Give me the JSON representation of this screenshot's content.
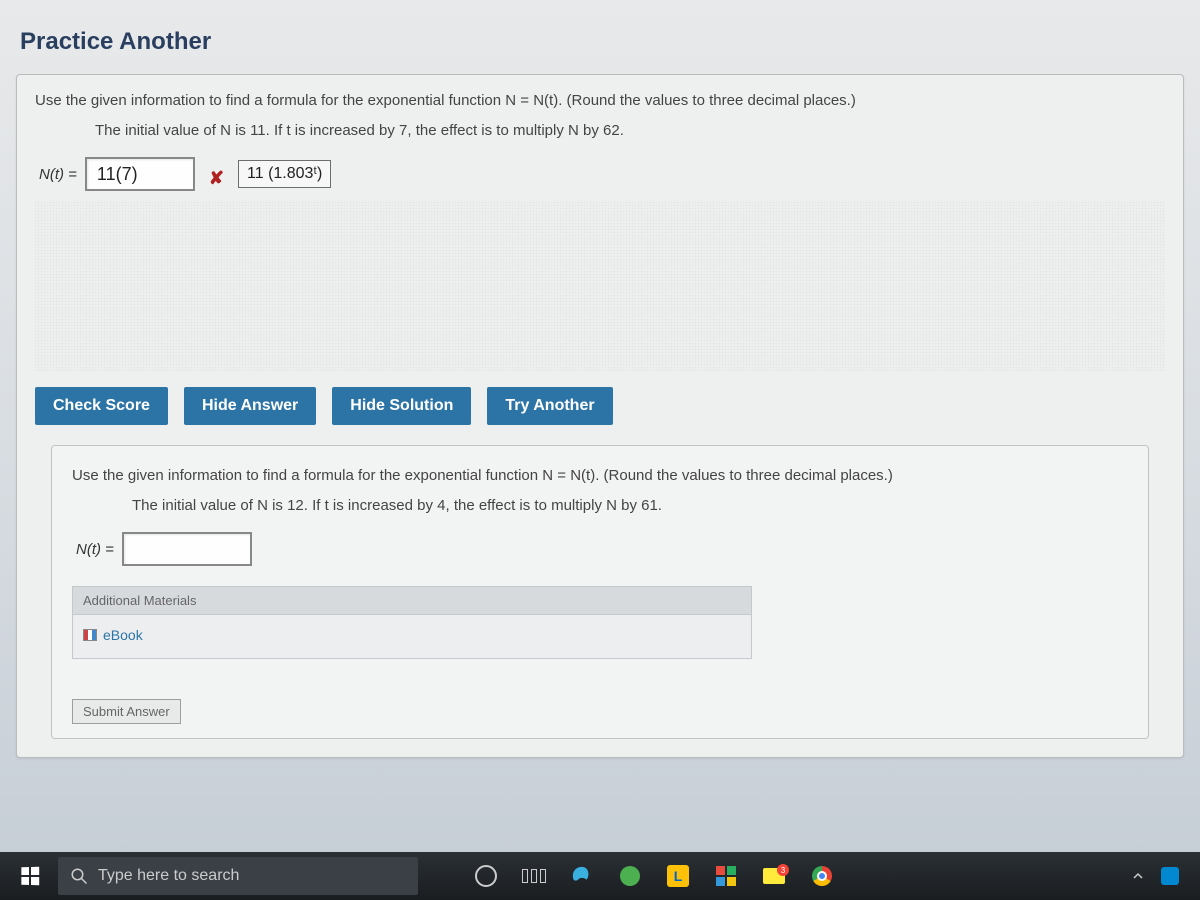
{
  "page_title": "Practice Another",
  "problem1": {
    "prompt_main": "Use the given information to find a formula for the exponential function N = N(t). (Round the values to three decimal places.)",
    "prompt_sub": "The initial value of N is 11. If t is increased by 7, the effect is to multiply N by 62.",
    "label": "N(t) =",
    "user_answer": "11(7)",
    "incorrect_mark": "✘",
    "solution": "11 (1.803ᵗ)",
    "buttons": {
      "check": "Check Score",
      "hide_answer": "Hide Answer",
      "hide_solution": "Hide Solution",
      "try_another": "Try Another"
    }
  },
  "problem2": {
    "prompt_main": "Use the given information to find a formula for the exponential function N = N(t). (Round the values to three decimal places.)",
    "prompt_sub": "The initial value of N is 12. If t is increased by 4, the effect is to multiply N by 61.",
    "label": "N(t) =",
    "additional_materials_header": "Additional Materials",
    "ebook_label": "eBook",
    "submit_label": "Submit Answer"
  },
  "taskbar": {
    "search_placeholder": "Type here to search"
  }
}
